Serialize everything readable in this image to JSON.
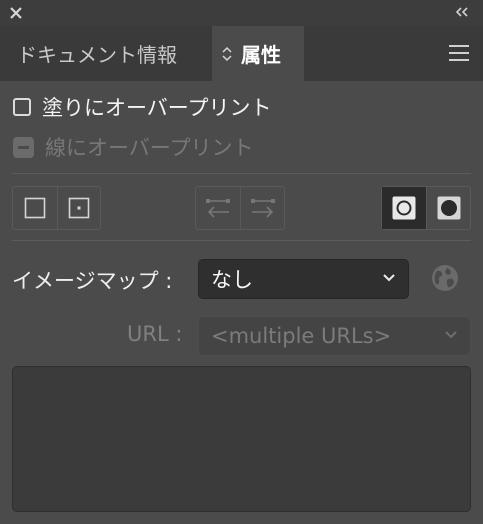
{
  "titlebar": {
    "close_icon": "close-icon",
    "collapse_icon": "double-chevron-left-icon"
  },
  "tabs": [
    {
      "label": "ドキュメント情報",
      "active": false
    },
    {
      "label": "属性",
      "active": true
    }
  ],
  "options": {
    "overprint_fill": {
      "label": "塗りにオーバープリント",
      "checked": false,
      "enabled": true
    },
    "overprint_stroke": {
      "label": "線にオーバープリント",
      "checked": "mixed",
      "enabled": false
    }
  },
  "buttons": {
    "overprint_group": [
      "show-center-off-icon",
      "show-center-on-icon"
    ],
    "direction_group": [
      "reverse-path-left-icon",
      "reverse-path-right-icon"
    ],
    "fill_rule_group": [
      "nonzero-winding-icon",
      "even-odd-icon"
    ],
    "fill_rule_selected": "nonzero-winding-icon"
  },
  "image_map": {
    "label": "イメージマップ :",
    "value": "なし"
  },
  "url": {
    "label": "URL :",
    "value": "<multiple URLs>",
    "enabled": false
  },
  "colors": {
    "panel": "#4b4b4b",
    "tabbar": "#3a3a3a",
    "field": "#2f2f2f"
  }
}
